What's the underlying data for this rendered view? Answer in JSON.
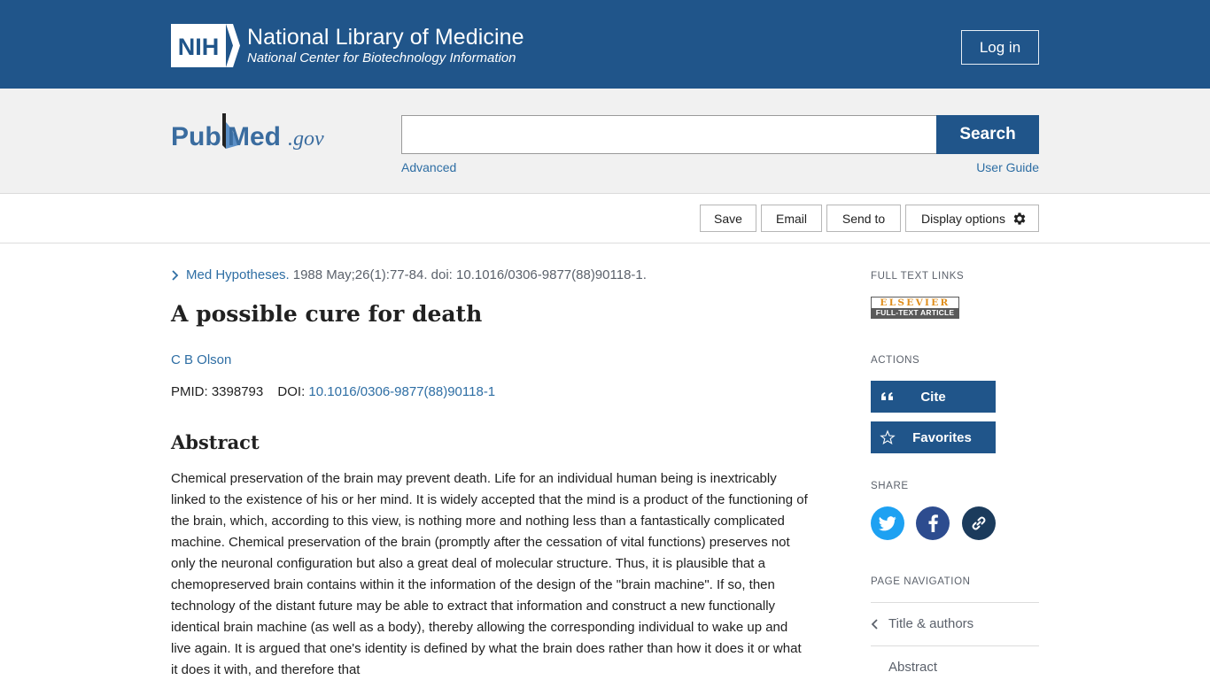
{
  "header": {
    "logo_text": "NIH",
    "title": "National Library of Medicine",
    "subtitle": "National Center for Biotechnology Information",
    "login_label": "Log in"
  },
  "search": {
    "logo_text": "PubMed.gov",
    "value": "",
    "button_label": "Search",
    "advanced_label": "Advanced",
    "guide_label": "User Guide"
  },
  "toolbar": {
    "save_label": "Save",
    "email_label": "Email",
    "send_label": "Send to",
    "display_label": "Display options"
  },
  "article": {
    "journal": "Med Hypotheses.",
    "citation": "1988 May;26(1):77-84. doi: 10.1016/0306-9877(88)90118-1.",
    "title": "A possible cure for death",
    "author": "C B Olson",
    "pmid_label": "PMID: 3398793",
    "doi_label": "DOI:",
    "doi_value": "10.1016/0306-9877(88)90118-1",
    "abstract_heading": "Abstract",
    "abstract_text": "Chemical preservation of the brain may prevent death. Life for an individual human being is inextricably linked to the existence of his or her mind. It is widely accepted that the mind is a product of the functioning of the brain, which, according to this view, is nothing more and nothing less than a fantastically complicated machine. Chemical preservation of the brain (promptly after the cessation of vital functions) preserves not only the neuronal configuration but also a great deal of molecular structure. Thus, it is plausible that a chemopreserved brain contains within it the information of the design of the \"brain machine\". If so, then technology of the distant future may be able to extract that information and construct a new functionally identical brain machine (as well as a body), thereby allowing the corresponding individual to wake up and live again. It is argued that one's identity is defined by what the brain does rather than how it does it or what it does it with, and therefore that"
  },
  "sidebar": {
    "full_text_label": "FULL TEXT LINKS",
    "elsevier_top": "ELSEVIER",
    "elsevier_bottom": "FULL-TEXT ARTICLE",
    "actions_label": "ACTIONS",
    "cite_label": "Cite",
    "favorites_label": "Favorites",
    "share_label": "SHARE",
    "page_nav_label": "PAGE NAVIGATION",
    "nav_items": [
      "Title & authors",
      "Abstract"
    ]
  },
  "colors": {
    "nih_blue": "#20558a",
    "link_blue": "#2e6ea4",
    "twitter": "#1da1f2",
    "facebook": "#2d4c8f",
    "permalink": "#1b3b5c"
  },
  "icons": [
    "nih-logo-icon",
    "pubmed-logo-icon",
    "gear-icon",
    "chevron-right-icon",
    "quote-icon",
    "star-icon",
    "twitter-icon",
    "facebook-icon",
    "link-icon",
    "chevron-left-icon"
  ]
}
